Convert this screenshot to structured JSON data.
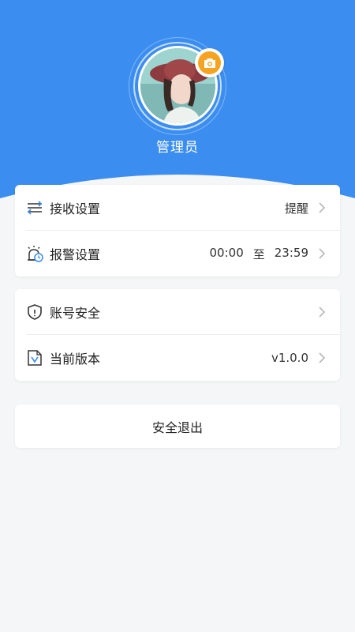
{
  "profile": {
    "username": "管理员"
  },
  "settings": {
    "receive": {
      "label": "接收设置",
      "value": "提醒"
    },
    "alarm": {
      "label": "报警设置",
      "start": "00:00",
      "to": "至",
      "end": "23:59"
    }
  },
  "account": {
    "security": {
      "label": "账号安全"
    },
    "version": {
      "label": "当前版本",
      "value": "v1.0.0"
    }
  },
  "logout": {
    "label": "安全退出"
  },
  "colors": {
    "header": "#3b8ef0",
    "camera_badge": "#f5a321",
    "background": "#f5f6f7"
  },
  "icons": [
    "camera-icon",
    "sliders-icon",
    "alarm-icon",
    "shield-icon",
    "document-icon",
    "chevron-right-icon"
  ]
}
